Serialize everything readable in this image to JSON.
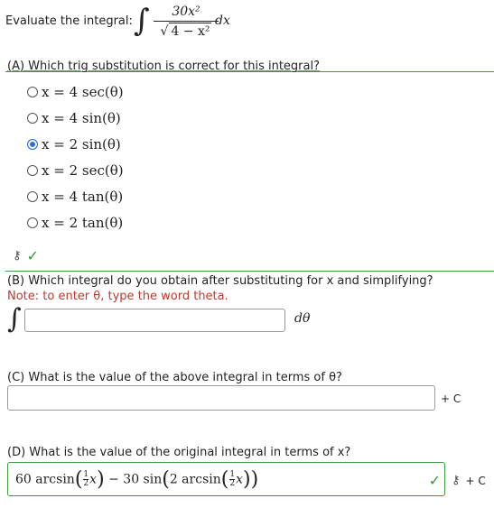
{
  "header": {
    "intro": "Evaluate the integral:",
    "numerator": "30x²",
    "denominator_prefix": "√",
    "denominator": "4 − x²",
    "dx": "dx"
  },
  "partA": {
    "question": "(A) Which trig substitution is correct for this integral?",
    "options": [
      {
        "label": "x = 4 sec(θ)",
        "selected": false
      },
      {
        "label": "x = 4 sin(θ)",
        "selected": false
      },
      {
        "label": "x = 2 sin(θ)",
        "selected": true
      },
      {
        "label": "x = 2 sec(θ)",
        "selected": false
      },
      {
        "label": "x = 4 tan(θ)",
        "selected": false
      },
      {
        "label": "x = 2 tan(θ)",
        "selected": false
      }
    ],
    "check": "✓"
  },
  "partB": {
    "question": "(B) Which integral do you obtain after substituting for x and simplifying?",
    "note": "Note: to enter θ, type the word theta.",
    "integral_sign": "∫",
    "input_value": "",
    "suffix": "dθ"
  },
  "partC": {
    "question": "(C) What is the value of the above integral in terms of θ?",
    "input_value": "",
    "suffix": "+ C"
  },
  "partD": {
    "question": "(D) What is the value of the original integral in terms of x?",
    "answer_part1": "60 arcsin",
    "answer_part2": "− 30 sin",
    "answer_part3": "2 arcsin",
    "frac_num": "1",
    "frac_den": "2",
    "var": "x",
    "check": "✓",
    "suffix": "+ C"
  },
  "colors": {
    "correct_green": "#3c9b3c",
    "note_red": "#c0392b",
    "radio_blue": "#2f6fd8"
  }
}
